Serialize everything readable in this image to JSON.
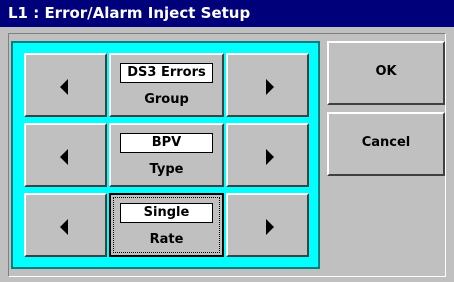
{
  "window": {
    "title": "L1 : Error/Alarm Inject Setup"
  },
  "rows": [
    {
      "value": "DS3 Errors",
      "label": "Group"
    },
    {
      "value": "BPV",
      "label": "Type"
    },
    {
      "value": "Single",
      "label": "Rate"
    }
  ],
  "buttons": {
    "ok": "OK",
    "cancel": "Cancel"
  },
  "icons": {
    "prev": "triangle-left-icon",
    "next": "triangle-right-icon"
  }
}
